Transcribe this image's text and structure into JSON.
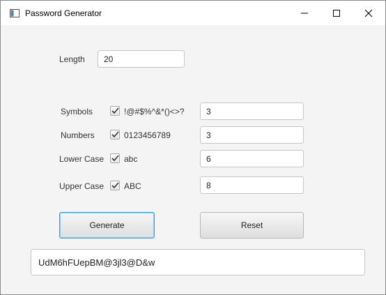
{
  "window": {
    "title": "Password Generator"
  },
  "length": {
    "label": "Length",
    "value": "20"
  },
  "options": [
    {
      "label": "Symbols",
      "checked": true,
      "chars": "!@#$%^&*()<>?",
      "count": "3"
    },
    {
      "label": "Numbers",
      "checked": true,
      "chars": "0123456789",
      "count": "3"
    },
    {
      "label": "Lower Case",
      "checked": true,
      "chars": "abc",
      "count": "6"
    },
    {
      "label": "Upper Case",
      "checked": true,
      "chars": "ABC",
      "count": "8"
    }
  ],
  "buttons": {
    "generate": "Generate",
    "reset": "Reset"
  },
  "output": {
    "password": "UdM6hFUepBM@3jl3@D&w"
  },
  "icons": {
    "window": "app-window-icon",
    "minimize": "minimize-icon",
    "maximize": "maximize-icon",
    "close": "close-icon",
    "check": "check-icon"
  },
  "colors": {
    "focus_ring": "#3c9fd9",
    "background": "#f4f4f4"
  }
}
